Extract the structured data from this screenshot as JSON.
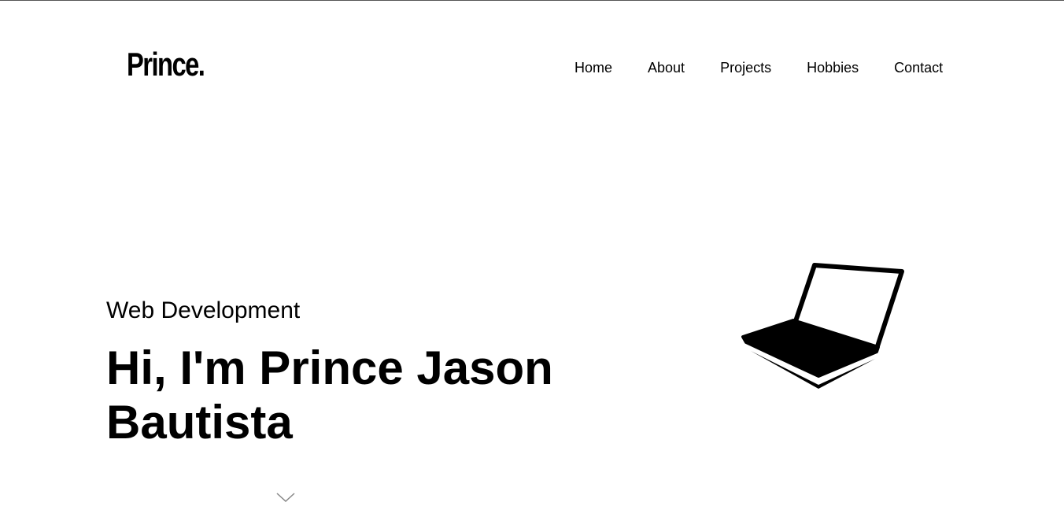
{
  "header": {
    "logo": "Prince.",
    "nav": [
      {
        "label": "Home"
      },
      {
        "label": "About"
      },
      {
        "label": "Projects"
      },
      {
        "label": "Hobbies"
      },
      {
        "label": "Contact"
      }
    ]
  },
  "hero": {
    "subtitle": "Web Development",
    "headline": "Hi, I'm Prince Jason Bautista",
    "illustration_icon": "laptop-icon",
    "scroll_icon": "chevron-down-icon"
  }
}
